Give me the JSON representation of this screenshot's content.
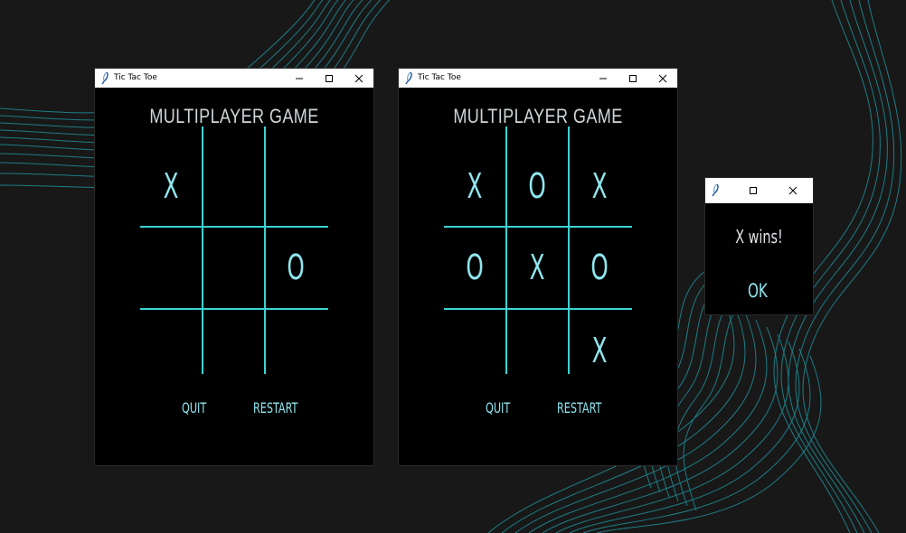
{
  "theme": {
    "accent": "#3ad3d3",
    "mark_color": "#8fe6ee",
    "background": "#181818",
    "window_bg": "#000000"
  },
  "windows": [
    {
      "title": "Tic Tac Toe",
      "heading": "MULTIPLAYER GAME",
      "board": [
        "X",
        "",
        "",
        "",
        "",
        "O",
        "",
        "",
        ""
      ],
      "buttons": {
        "quit": "QUIT",
        "restart": "RESTART"
      }
    },
    {
      "title": "Tic Tac Toe",
      "heading": "MULTIPLAYER GAME",
      "board": [
        "X",
        "O",
        "X",
        "O",
        "X",
        "O",
        "",
        "",
        "X"
      ],
      "buttons": {
        "quit": "QUIT",
        "restart": "RESTART"
      }
    }
  ],
  "popup": {
    "message": "X wins!",
    "ok_label": "OK"
  },
  "icons": {
    "app": "feather-icon",
    "minimize": "minimize-icon",
    "maximize": "maximize-icon",
    "close": "close-icon"
  }
}
